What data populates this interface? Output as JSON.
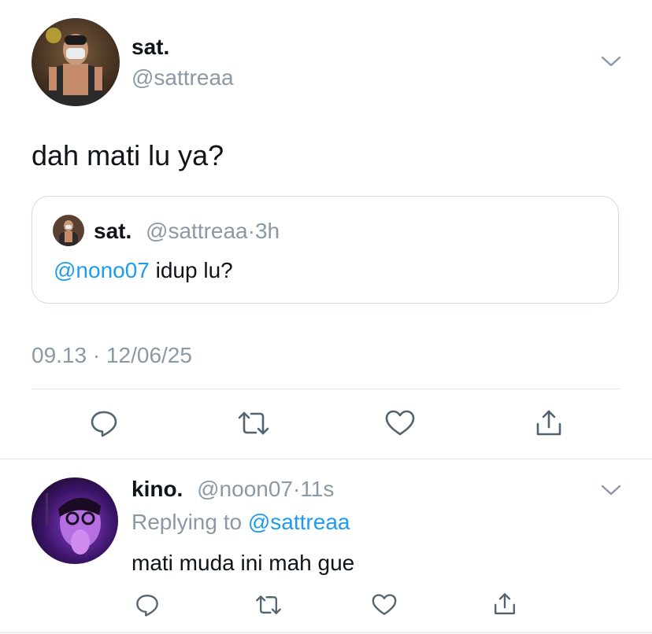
{
  "main_tweet": {
    "author_name": "sat.",
    "author_handle": "@sattreaa",
    "text": "dah mati lu ya?",
    "timestamp": "09.13 · 12/06/25",
    "quoted": {
      "author_name": "sat.",
      "author_handle": "@sattreaa",
      "time": "3h",
      "mention": "@nono07",
      "text": "idup lu?"
    }
  },
  "reply": {
    "author_name": "kino.",
    "author_handle": "@noon07",
    "time": "11s",
    "replying_prefix": "Replying to",
    "replying_handle": "@sattreaa",
    "text": "mati muda ini mah gue"
  },
  "icons": {
    "reply": "comment-icon",
    "retweet": "retweet-icon",
    "like": "heart-icon",
    "share": "share-icon",
    "more": "chevron-down-icon"
  },
  "colors": {
    "text": "#0f1419",
    "secondary": "#8b98a5",
    "link": "#1d9bf0",
    "border": "#cfd9de"
  }
}
